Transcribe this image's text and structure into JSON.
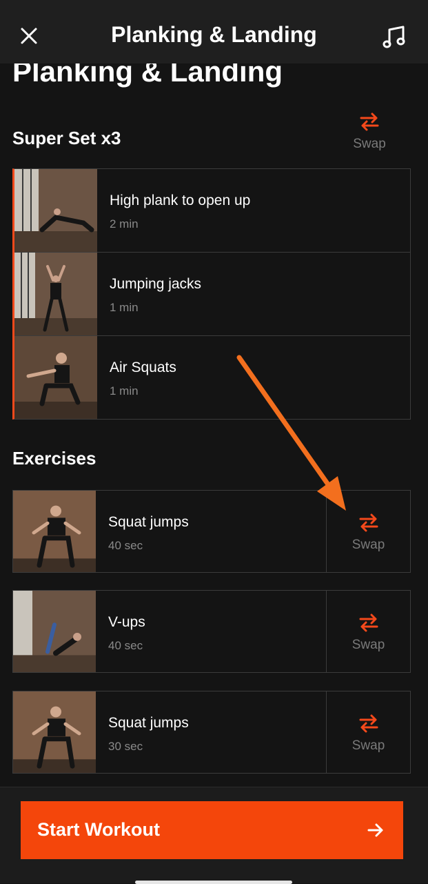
{
  "header": {
    "title": "Planking & Landing",
    "close_icon": "close-icon",
    "music_icon": "music-note-icon"
  },
  "page_title": "Planking & Landing",
  "superset": {
    "title": "Super Set x3",
    "swap_label": "Swap",
    "exercises": [
      {
        "name": "High plank to open up",
        "duration": "2 min"
      },
      {
        "name": "Jumping jacks",
        "duration": "1 min"
      },
      {
        "name": "Air Squats",
        "duration": "1 min"
      }
    ]
  },
  "exercises_section": {
    "title": "Exercises",
    "items": [
      {
        "name": "Squat jumps",
        "duration": "40 sec",
        "swap_label": "Swap"
      },
      {
        "name": "V-ups",
        "duration": "40 sec",
        "swap_label": "Swap"
      },
      {
        "name": "Squat jumps",
        "duration": "30 sec",
        "swap_label": "Swap"
      }
    ]
  },
  "footer": {
    "start_label": "Start Workout",
    "start_icon": "arrow-right-icon"
  },
  "colors": {
    "accent": "#f4460b",
    "background": "#141414",
    "header": "#1f1f1f",
    "border": "#3c3c3c",
    "muted_text": "#8a8a8a",
    "annotation_arrow": "#f36f1e"
  }
}
